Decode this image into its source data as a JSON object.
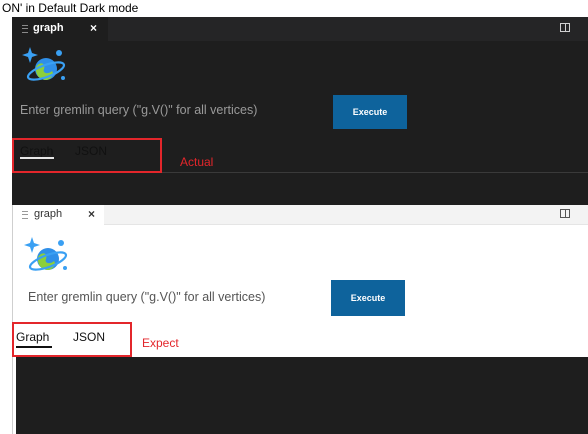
{
  "caption": "ON' in Default Dark mode",
  "actual": {
    "tab_title": "graph",
    "tab_close": "×",
    "query_placeholder": "Enter gremlin query (\"g.V()\" for all vertices)",
    "execute_label": "Execute",
    "tabs": [
      "Graph",
      "JSON"
    ],
    "annotation": "Actual"
  },
  "expect": {
    "tab_title": "graph",
    "tab_close": "×",
    "query_placeholder": "Enter gremlin query (\"g.V()\" for all vertices)",
    "execute_label": "Execute",
    "tabs": [
      "Graph",
      "JSON"
    ],
    "annotation": "Expect"
  },
  "colors": {
    "dark_bg": "#1e1e1e",
    "button_blue": "#0e639c",
    "annotation_red": "#e3262b"
  },
  "icons": [
    "cosmos-db-planet-icon",
    "split-editor-icon",
    "close-icon"
  ]
}
